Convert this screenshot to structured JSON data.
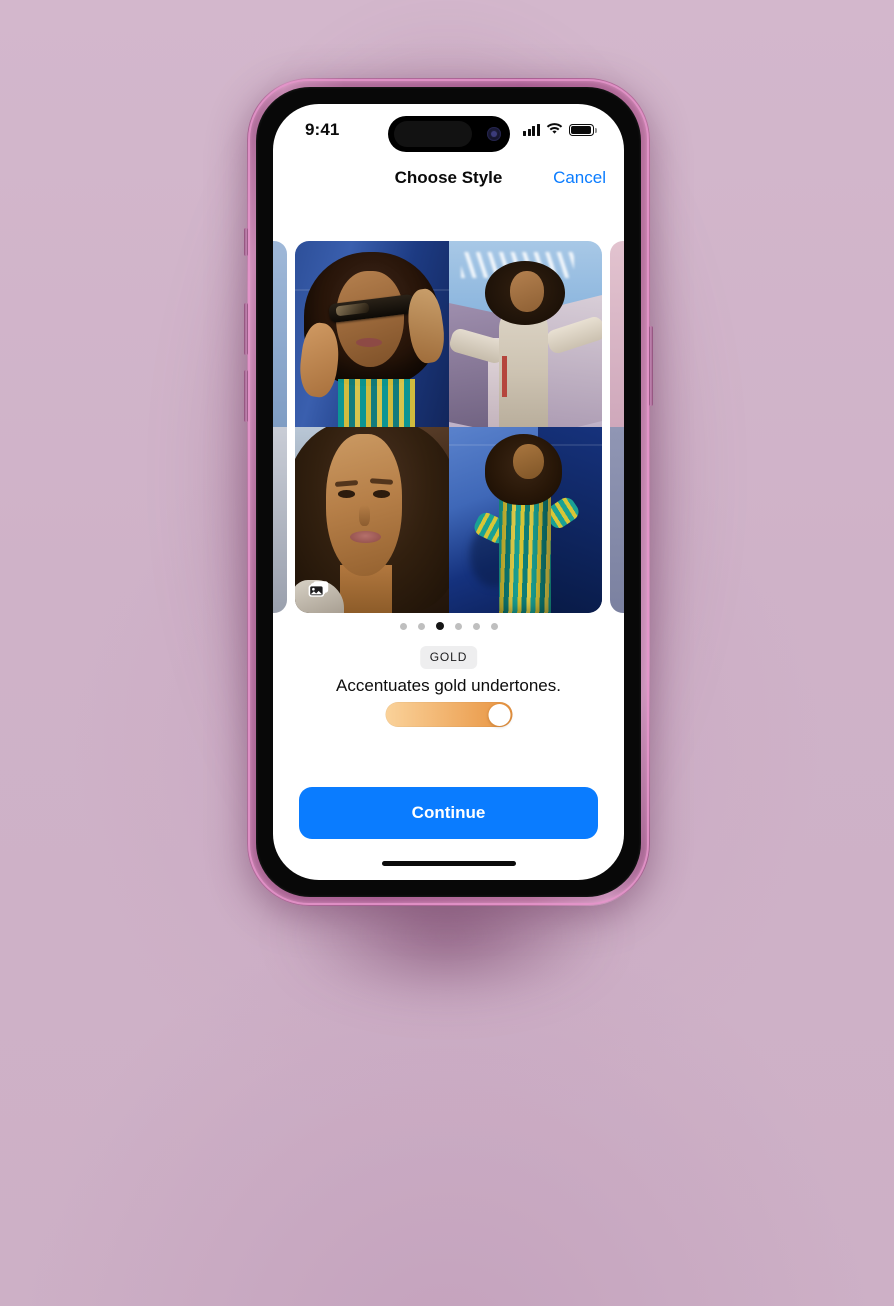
{
  "background": {
    "base_color": "#cfb2c8",
    "accent_glow": "#783664"
  },
  "device": {
    "frame_color": "#b06e9b",
    "frame_highlight": "#e896cd",
    "bezel_color": "#080808",
    "side_buttons": [
      {
        "name": "mute-switch"
      },
      {
        "name": "volume-up-button"
      },
      {
        "name": "volume-down-button"
      },
      {
        "name": "power-button"
      }
    ]
  },
  "status_bar": {
    "time": "9:41",
    "cellular_bars": 4,
    "cellular_icon": "cellular-bars-icon",
    "wifi_icon": "wifi-icon",
    "battery_icon": "battery-full-icon",
    "battery_level_percent": 100,
    "dynamic_island": {
      "camera_icon": "front-camera-icon"
    }
  },
  "nav_bar": {
    "title": "Choose Style",
    "cancel_label": "Cancel",
    "cancel_color": "#0a7cff"
  },
  "carousel": {
    "peek_left": {
      "name": "previous-style-card"
    },
    "peek_right": {
      "name": "next-style-card"
    },
    "current_card": {
      "photo_stack_icon": "photo-stack-icon",
      "photos": [
        {
          "position": "top-left",
          "description": "Woman in sunglasses against blue wall"
        },
        {
          "position": "top-right",
          "description": "Woman in cream top against blue sky architecture"
        },
        {
          "position": "bottom-left",
          "description": "Close-up portrait of woman with curly hair"
        },
        {
          "position": "bottom-right",
          "description": "Woman in striped green dress against blue wall"
        }
      ]
    }
  },
  "pagination": {
    "total": 6,
    "active_index": 2
  },
  "style": {
    "badge_label": "GOLD",
    "description": "Accentuates gold undertones.",
    "badge_bg": "#eeeeef"
  },
  "intensity_slider": {
    "value_percent": 100,
    "gradient_start": "#fad29a",
    "gradient_end": "#e89340",
    "knob_color": "#ffffff"
  },
  "primary_action": {
    "label": "Continue",
    "color": "#0a7cff"
  },
  "home_indicator": {
    "name": "home-indicator"
  }
}
